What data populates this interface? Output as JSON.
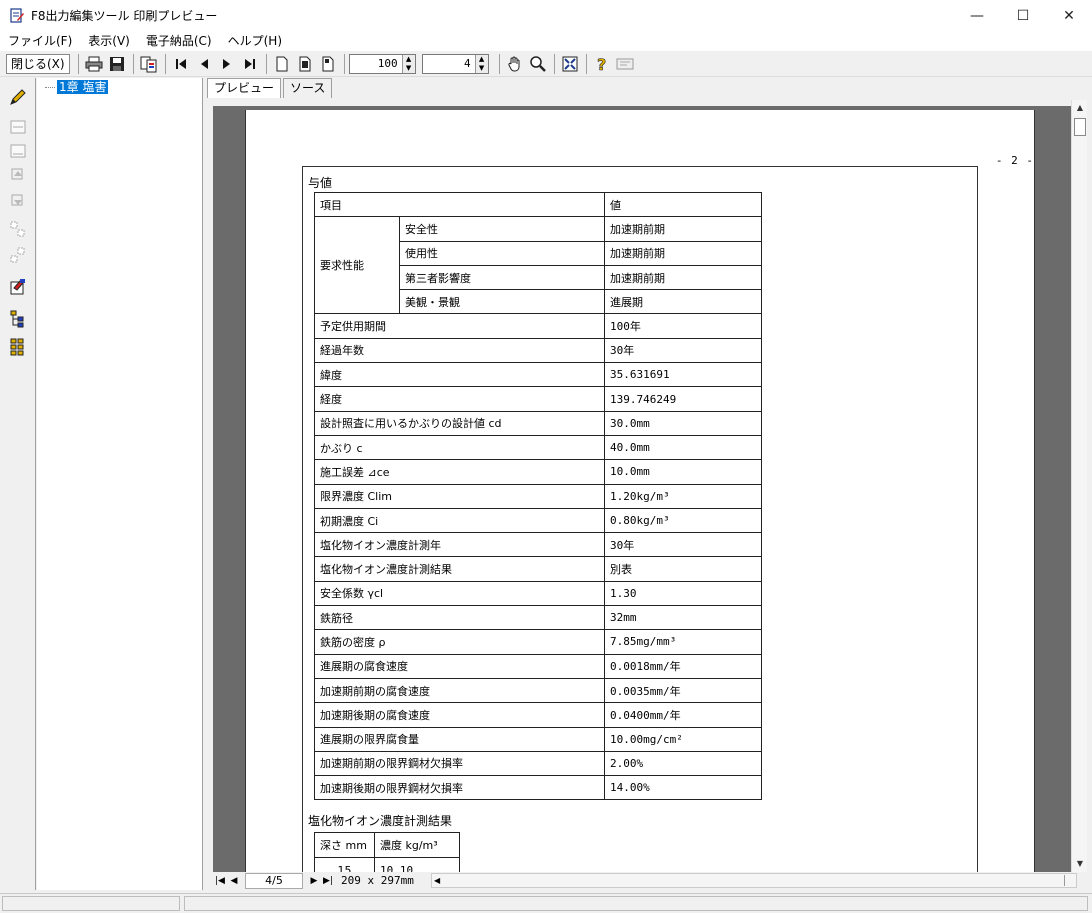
{
  "window": {
    "title": "F8出力編集ツール 印刷プレビュー",
    "minimize": "—",
    "maximize": "☐",
    "close": "✕"
  },
  "menu": [
    "ファイル(F)",
    "表示(V)",
    "電子納品(C)",
    "ヘルプ(H)"
  ],
  "toolbar": {
    "close_label": "閉じる(X)",
    "zoom_value": "100",
    "page_value": "4"
  },
  "tree": {
    "root_label": "1章 塩害"
  },
  "tabs": [
    "プレビュー",
    "ソース"
  ],
  "page": {
    "page_number": "- 2 -",
    "section1_title": "与値",
    "section2_title": "塩化物イオン濃度計測結果",
    "params_header": [
      "項目",
      "値"
    ],
    "group_label": "要求性能",
    "group_rows": [
      {
        "label": "安全性",
        "value": "加速期前期"
      },
      {
        "label": "使用性",
        "value": "加速期前期"
      },
      {
        "label": "第三者影響度",
        "value": "加速期前期"
      },
      {
        "label": "美観・景観",
        "value": "進展期"
      }
    ],
    "rows": [
      {
        "label": "予定供用期間",
        "value": " 100年"
      },
      {
        "label": "経過年数",
        "value": "  30年"
      },
      {
        "label": "緯度",
        "value": "35.631691"
      },
      {
        "label": "経度",
        "value": "139.746249"
      },
      {
        "label": "設計照査に用いるかぶりの設計値 cd",
        "value": " 30.0mm"
      },
      {
        "label": "かぶり c",
        "value": " 40.0mm"
      },
      {
        "label": "施工誤差 ⊿ce",
        "value": " 10.0mm"
      },
      {
        "label": "限界濃度 Clim",
        "value": " 1.20kg/m³"
      },
      {
        "label": "初期濃度 Ci",
        "value": " 0.80kg/m³"
      },
      {
        "label": "塩化物イオン濃度計測年",
        "value": "  30年"
      },
      {
        "label": "塩化物イオン濃度計測結果",
        "value": "別表"
      },
      {
        "label": "安全係数 γcl",
        "value": "1.30"
      },
      {
        "label": "鉄筋径",
        "value": "32mm"
      },
      {
        "label": "鉄筋の密度 ρ",
        "value": "7.85mg/mm³"
      },
      {
        "label": "進展期の腐食速度",
        "value": "0.0018mm/年"
      },
      {
        "label": "加速期前期の腐食速度",
        "value": "0.0035mm/年"
      },
      {
        "label": "加速期後期の腐食速度",
        "value": "0.0400mm/年"
      },
      {
        "label": "進展期の限界腐食量",
        "value": "10.00mg/cm²"
      },
      {
        "label": "加速期前期の限界鋼材欠損率",
        "value": "2.00%"
      },
      {
        "label": "加速期後期の限界鋼材欠損率",
        "value": "14.00%"
      }
    ],
    "depth_header": [
      "深さ mm",
      "濃度 kg/m³"
    ],
    "depth_rows": [
      {
        "depth": "15",
        "conc": "10.10"
      }
    ]
  },
  "preview_nav": {
    "page_indicator": "4/5",
    "paper_size": "209 x 297mm"
  },
  "colors": {
    "selection": "#0078d7",
    "preview_background": "#6b6b6b"
  }
}
